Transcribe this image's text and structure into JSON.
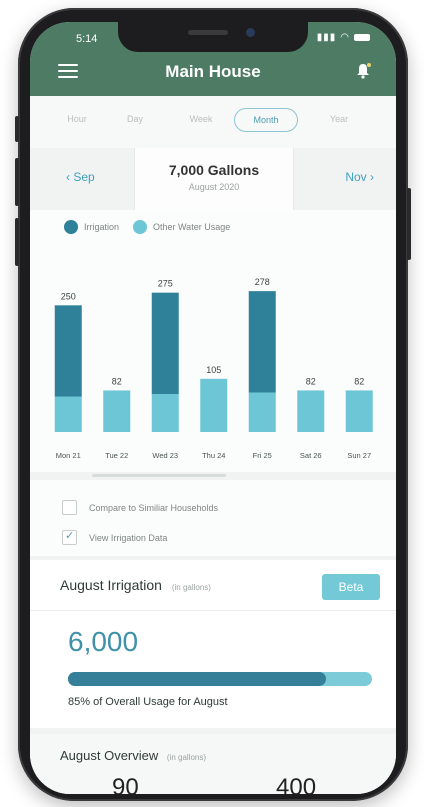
{
  "status": {
    "time": "5:14"
  },
  "header": {
    "title": "Main House"
  },
  "tabs": [
    {
      "label": "Hour",
      "active": false
    },
    {
      "label": "Day",
      "active": false
    },
    {
      "label": "Week",
      "active": false
    },
    {
      "label": "Month",
      "active": true
    },
    {
      "label": "Year",
      "active": false
    }
  ],
  "nav": {
    "prev": "Sep",
    "next": "Nov",
    "total": "7,000 Gallons",
    "period": "August 2020"
  },
  "legend": {
    "irrigation": "Irrigation",
    "other": "Other Water Usage"
  },
  "colors": {
    "brand": "#4e7b63",
    "irrigation": "#2f8099",
    "other": "#6cc6d6",
    "accent": "#3fa0bf"
  },
  "chart_data": {
    "type": "bar",
    "stacked": true,
    "categories": [
      "Mon 21",
      "Tue 22",
      "Wed 23",
      "Thu 24",
      "Fri 25",
      "Sat 26",
      "Sun 27"
    ],
    "totals": [
      250,
      82,
      275,
      105,
      278,
      82,
      82
    ],
    "series": [
      {
        "name": "Irrigation",
        "values": [
          180,
          0,
          200,
          0,
          200,
          0,
          0
        ]
      },
      {
        "name": "Other Water Usage",
        "values": [
          70,
          82,
          75,
          105,
          78,
          82,
          82
        ]
      }
    ],
    "ylim": [
      0,
      300
    ],
    "legend_position": "top-left"
  },
  "options": {
    "compare_label": "Compare to Similiar Households",
    "compare_checked": false,
    "irrigation_label": "View Irrigation Data",
    "irrigation_checked": true
  },
  "irrigation_card": {
    "title": "August Irrigation",
    "unit_note": "(in gallons)",
    "beta_label": "Beta",
    "value": "6,000",
    "percent": 85,
    "percent_label": "85% of Overall Usage for August"
  },
  "overview_card": {
    "title": "August Overview",
    "unit_note": "(in gallons)",
    "value_left": "90",
    "value_right": "400"
  }
}
